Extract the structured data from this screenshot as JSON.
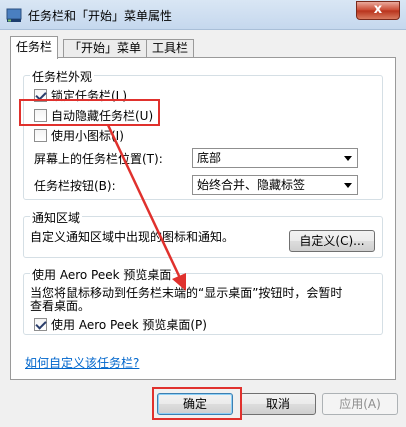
{
  "window": {
    "title": "任务栏和「开始」菜单属性",
    "close_label": "x"
  },
  "tabs": [
    {
      "label": "任务栏",
      "active": true
    },
    {
      "label": "「开始」菜单",
      "active": false
    },
    {
      "label": "工具栏",
      "active": false
    }
  ],
  "appearance": {
    "title": "任务栏外观",
    "lock": {
      "label": "锁定任务栏(L)",
      "checked": true
    },
    "autohide": {
      "label": "自动隐藏任务栏(U)",
      "checked": false
    },
    "small_icons": {
      "label": "使用小图标(I)",
      "checked": false
    },
    "position_label": "屏幕上的任务栏位置(T):",
    "position_value": "底部",
    "buttons_label": "任务栏按钮(B):",
    "buttons_value": "始终合并、隐藏标签"
  },
  "notification": {
    "title": "通知区域",
    "desc": "自定义通知区域中出现的图标和通知。",
    "customize_button": "自定义(C)..."
  },
  "aero": {
    "title": "使用 Aero Peek 预览桌面",
    "desc_line1": "当您将鼠标移动到任务栏末端的“显示桌面”按钮时，会暂时",
    "desc_line2": "查看桌面。",
    "checkbox": {
      "label": "使用 Aero Peek 预览桌面(P)",
      "checked": true
    }
  },
  "help_link": "如何自定义该任务栏?",
  "footer": {
    "ok": "确定",
    "cancel": "取消",
    "apply": "应用(A)"
  },
  "colors": {
    "highlight": "#e0312d",
    "link": "#0066cc"
  }
}
